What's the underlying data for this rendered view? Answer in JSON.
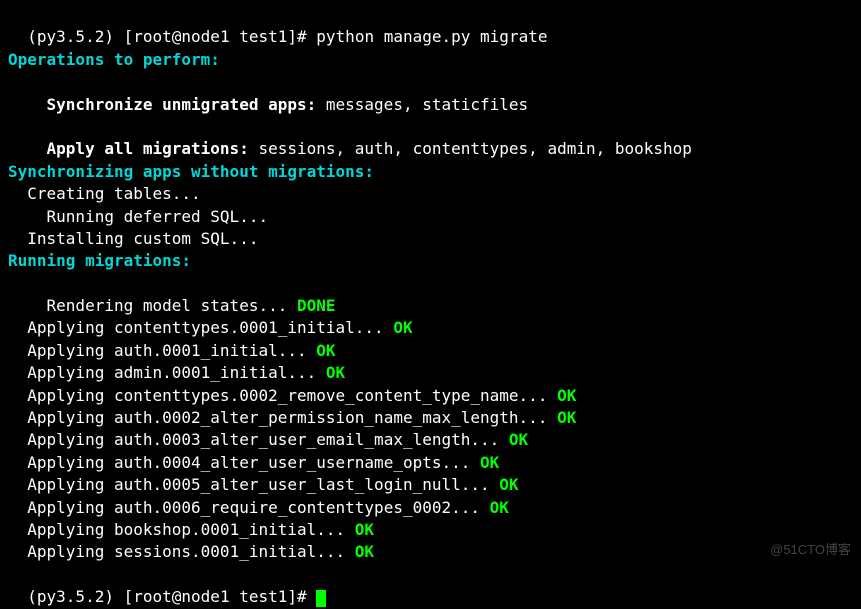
{
  "prompt1": {
    "env": "(py3.5.2)",
    "userhost": "[root@node1 test1]#",
    "command": "python manage.py migrate"
  },
  "sections": {
    "operations_header": "Operations to perform:",
    "sync_apps_label": "Synchronize unmigrated apps:",
    "sync_apps_value": " messages, staticfiles",
    "apply_all_label": "Apply all migrations:",
    "apply_all_value": " sessions, auth, contenttypes, admin, bookshop",
    "sync_without_header": "Synchronizing apps without migrations:",
    "creating_tables": "Creating tables...",
    "running_deferred": "Running deferred SQL...",
    "installing_custom": "Installing custom SQL...",
    "running_header": "Running migrations:",
    "render_states": "Rendering model states...",
    "done": " DONE"
  },
  "applying_label": "Applying ",
  "ok_label": " OK",
  "migrations": [
    "contenttypes.0001_initial...",
    "auth.0001_initial...",
    "admin.0001_initial...",
    "contenttypes.0002_remove_content_type_name...",
    "auth.0002_alter_permission_name_max_length...",
    "auth.0003_alter_user_email_max_length...",
    "auth.0004_alter_user_username_opts...",
    "auth.0005_alter_user_last_login_null...",
    "auth.0006_require_contenttypes_0002...",
    "bookshop.0001_initial...",
    "sessions.0001_initial..."
  ],
  "prompt2": {
    "env": "(py3.5.2)",
    "userhost": "[root@node1 test1]#"
  },
  "watermark": "@51CTO博客"
}
